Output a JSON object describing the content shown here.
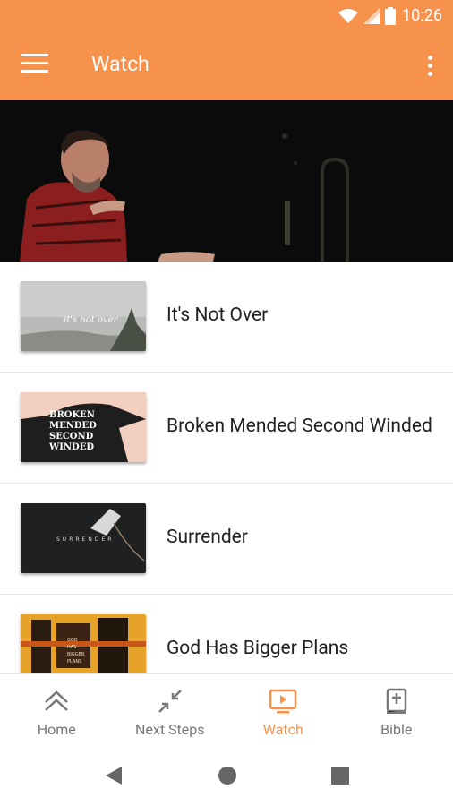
{
  "status_bar": {
    "time": "10:26",
    "icons": [
      "wifi-icon",
      "signal-icon",
      "battery-icon"
    ]
  },
  "app_bar": {
    "title": "Watch",
    "icons": [
      "menu-icon",
      "more-vert-icon"
    ],
    "background": "#f7924d"
  },
  "videos": [
    {
      "title": "It's Not Over",
      "thumb_text": "it's not over"
    },
    {
      "title": "Broken Mended Second Winded",
      "thumb_text": "BROKEN MENDED SECOND WINDED"
    },
    {
      "title": "Surrender",
      "thumb_text": "SURRENDER"
    },
    {
      "title": "God Has Bigger Plans",
      "thumb_text": "GOD HAS BIGGER PLANS"
    }
  ],
  "bottom_nav": {
    "items": [
      {
        "label": "Home",
        "icon": "double-chevron-up-icon",
        "active": false
      },
      {
        "label": "Next Steps",
        "icon": "compress-arrows-icon",
        "active": false
      },
      {
        "label": "Watch",
        "icon": "tv-play-icon",
        "active": true
      },
      {
        "label": "Bible",
        "icon": "bible-icon",
        "active": false
      }
    ],
    "accent": "#f7924d"
  },
  "system_nav": {
    "icons": [
      "back-icon",
      "home-circle-icon",
      "recents-square-icon"
    ]
  }
}
